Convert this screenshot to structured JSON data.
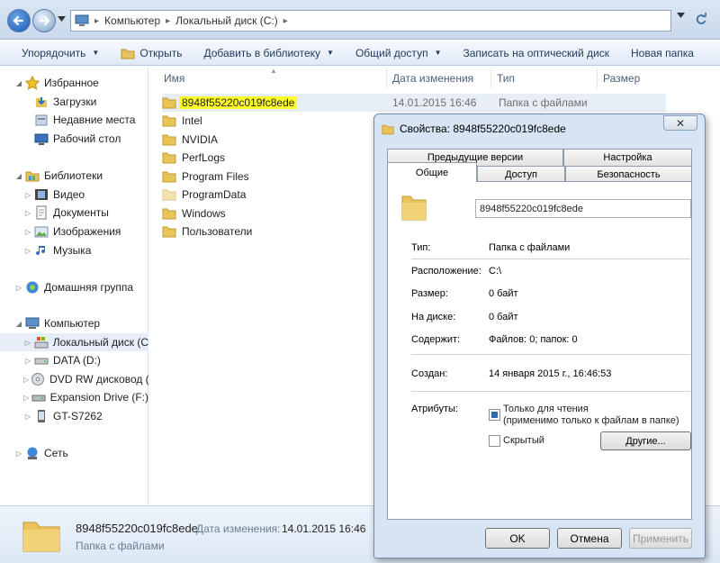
{
  "address": {
    "crumbs": [
      "Компьютер",
      "Локальный диск (C:)"
    ]
  },
  "toolbar": {
    "organize": "Упорядочить",
    "open": "Открыть",
    "add_to_library": "Добавить в библиотеку",
    "share": "Общий доступ",
    "burn": "Записать на оптический диск",
    "new_folder": "Новая папка"
  },
  "sidebar": {
    "favorites": "Избранное",
    "downloads": "Загрузки",
    "recent": "Недавние места",
    "desktop": "Рабочий стол",
    "libraries": "Библиотеки",
    "video": "Видео",
    "documents": "Документы",
    "images": "Изображения",
    "music": "Музыка",
    "homegroup": "Домашняя группа",
    "computer": "Компьютер",
    "local_disk": "Локальный диск (C",
    "data": "DATA (D:)",
    "dvd": "DVD RW дисковод (",
    "expansion": "Expansion Drive (F:)",
    "phone": "GT-S7262",
    "network": "Сеть"
  },
  "columns": {
    "name": "Имя",
    "date": "Дата изменения",
    "type": "Тип",
    "size": "Размер"
  },
  "files": [
    {
      "name": "8948f55220c019fc8ede",
      "date": "14.01.2015 16:46",
      "type": "Папка с файлами"
    },
    {
      "name": "Intel"
    },
    {
      "name": "NVIDIA"
    },
    {
      "name": "PerfLogs"
    },
    {
      "name": "Program Files"
    },
    {
      "name": "ProgramData"
    },
    {
      "name": "Windows"
    },
    {
      "name": "Пользователи"
    }
  ],
  "status": {
    "name": "8948f55220c019fc8ede",
    "date_label": "Дата изменения:",
    "date_value": "14.01.2015 16:46",
    "type": "Папка с файлами"
  },
  "dialog": {
    "title": "Свойства: 8948f55220c019fc8ede",
    "close": "✕",
    "tabs": {
      "prev_versions": "Предыдущие версии",
      "customize": "Настройка",
      "general": "Общие",
      "access": "Доступ",
      "security": "Безопасность"
    },
    "folder_name": "8948f55220c019fc8ede",
    "type_label": "Тип:",
    "type_value": "Папка с файлами",
    "location_label": "Расположение:",
    "location_value": "C:\\",
    "size_label": "Размер:",
    "size_value": "0 байт",
    "ondisk_label": "На диске:",
    "ondisk_value": "0 байт",
    "contains_label": "Содержит:",
    "contains_value": "Файлов: 0; папок: 0",
    "created_label": "Создан:",
    "created_value": "14 января 2015 г., 16:46:53",
    "attributes_label": "Атрибуты:",
    "readonly_line1": "Только для чтения",
    "readonly_line2": "(применимо только к файлам в папке)",
    "hidden": "Скрытый",
    "other_button": "Другие...",
    "ok": "OK",
    "cancel": "Отмена",
    "apply": "Применить"
  }
}
